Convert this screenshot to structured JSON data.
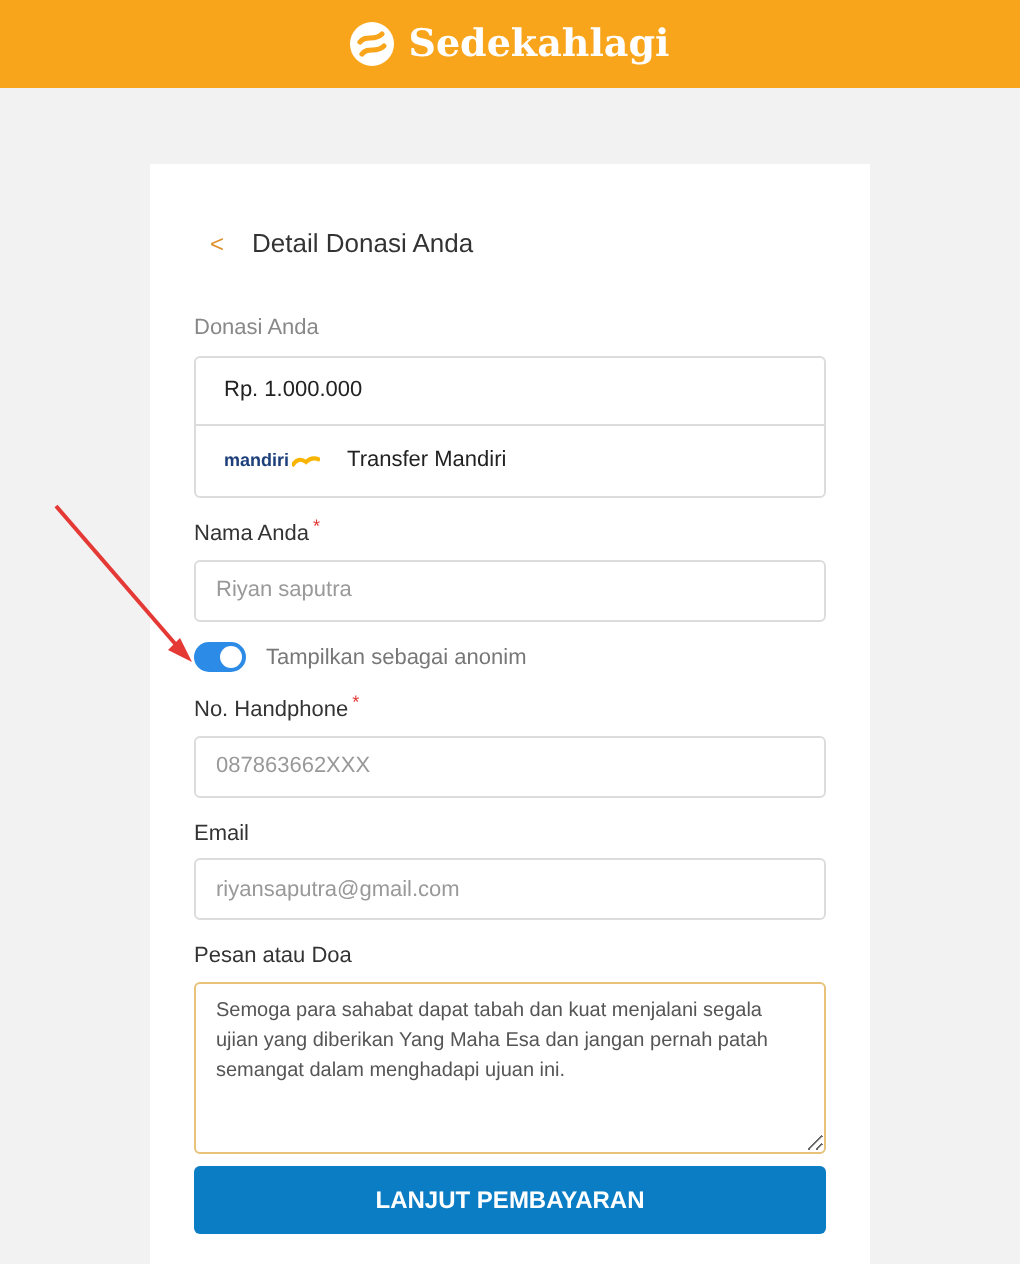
{
  "header": {
    "brand": "Sedekahlagi"
  },
  "page": {
    "title": "Detail Donasi Anda",
    "back_icon": "<"
  },
  "donation": {
    "label": "Donasi Anda",
    "amount": "Rp. 1.000.000",
    "bank_logo_text": "mandiri",
    "method": "Transfer Mandiri"
  },
  "fields": [
    {
      "kind": "input",
      "label": "Nama Anda",
      "required_mark": "*",
      "placeholder": "Riyan saputra"
    },
    {
      "kind": "toggle",
      "label": "Tampilkan sebagai anonim",
      "on": true
    },
    {
      "kind": "input",
      "label": "No. Handphone",
      "required_mark": "*",
      "placeholder": "087863662XXX"
    },
    {
      "kind": "input",
      "label": "Email",
      "placeholder": "riyansaputra@gmail.com"
    },
    {
      "kind": "textarea",
      "label": "Pesan atau Doa",
      "value": "Semoga para sahabat dapat tabah dan kuat menjalani segala ujian yang diberikan Yang Maha Esa dan jangan pernah patah semangat dalam menghadapi ujuan ini."
    }
  ],
  "submit": "LANJUT PEMBAYARAN"
}
